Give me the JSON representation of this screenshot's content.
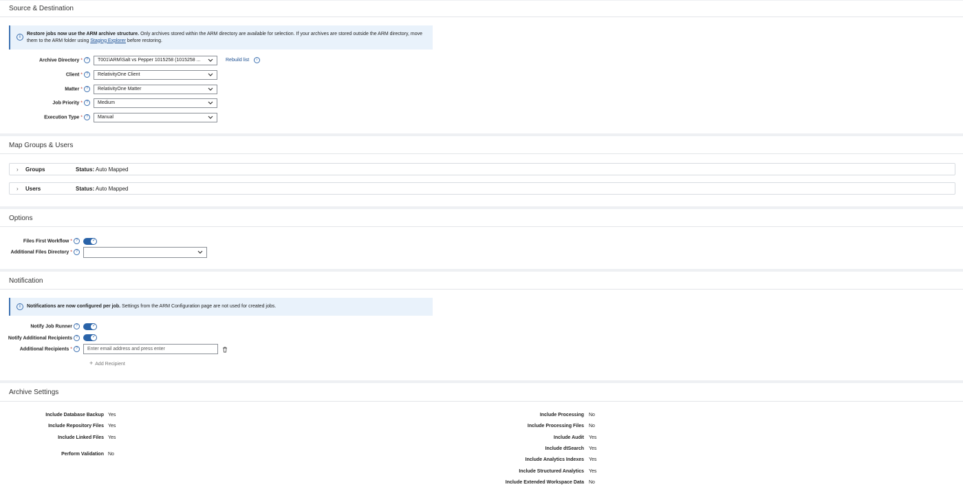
{
  "source": {
    "title": "Source & Destination",
    "info_bold": "Restore jobs now use the ARM archive structure.",
    "info_text": " Only archives stored within the ARM directory are available for selection. If your archives are stored outside the ARM directory, move them to the ARM folder using ",
    "info_link": "Staging Explorer",
    "info_after": " before restoring.",
    "fields": {
      "archive_dir": {
        "label": "Archive Directory",
        "value": "T001\\ARM\\Salt vs Pepper 1015258 (1015258 ..."
      },
      "client": {
        "label": "Client",
        "value": "RelativityOne Client"
      },
      "matter": {
        "label": "Matter",
        "value": "RelativityOne Matter"
      },
      "priority": {
        "label": "Job Priority",
        "value": "Medium"
      },
      "execution": {
        "label": "Execution Type",
        "value": "Manual"
      }
    },
    "rebuild_label": "Rebuild list"
  },
  "map": {
    "title": "Map Groups & Users",
    "status_label": "Status:",
    "groups": {
      "name": "Groups",
      "status": "Auto Mapped"
    },
    "users": {
      "name": "Users",
      "status": "Auto Mapped"
    }
  },
  "options": {
    "title": "Options",
    "files_first_label": "Files First Workflow",
    "files_first_on": true,
    "additional_dir_label": "Additional Files Directory",
    "additional_dir_value": ""
  },
  "notification": {
    "title": "Notification",
    "info_bold": "Notifications are now configured per job.",
    "info_text": " Settings from the ARM Configuration page are not used for created jobs.",
    "notify_runner_label": "Notify Job Runner",
    "notify_additional_label": "Notify Additional Recipients",
    "recipients_label": "Additional Recipients",
    "recipients_placeholder": "Enter email address and press enter",
    "add_recipient_label": "Add Recipient"
  },
  "archive": {
    "title": "Archive Settings",
    "left": [
      {
        "label": "Include Database Backup",
        "value": "Yes"
      },
      {
        "label": "Include Repository Files",
        "value": "Yes"
      },
      {
        "label": "Include Linked Files",
        "value": "Yes"
      },
      {
        "label": "Perform Validation",
        "value": "No"
      }
    ],
    "right": [
      {
        "label": "Include Processing",
        "value": "No"
      },
      {
        "label": "Include Processing Files",
        "value": "No"
      },
      {
        "label": "Include Audit",
        "value": "Yes"
      },
      {
        "label": "Include dtSearch",
        "value": "Yes"
      },
      {
        "label": "Include Analytics Indexes",
        "value": "Yes"
      },
      {
        "label": "Include Structured Analytics",
        "value": "Yes"
      },
      {
        "label": "Include Extended Workspace Data",
        "value": "No"
      }
    ]
  },
  "colors": {
    "accent": "#2a63a8",
    "info_bg": "#e9f2fb",
    "required": "#c0392b"
  }
}
